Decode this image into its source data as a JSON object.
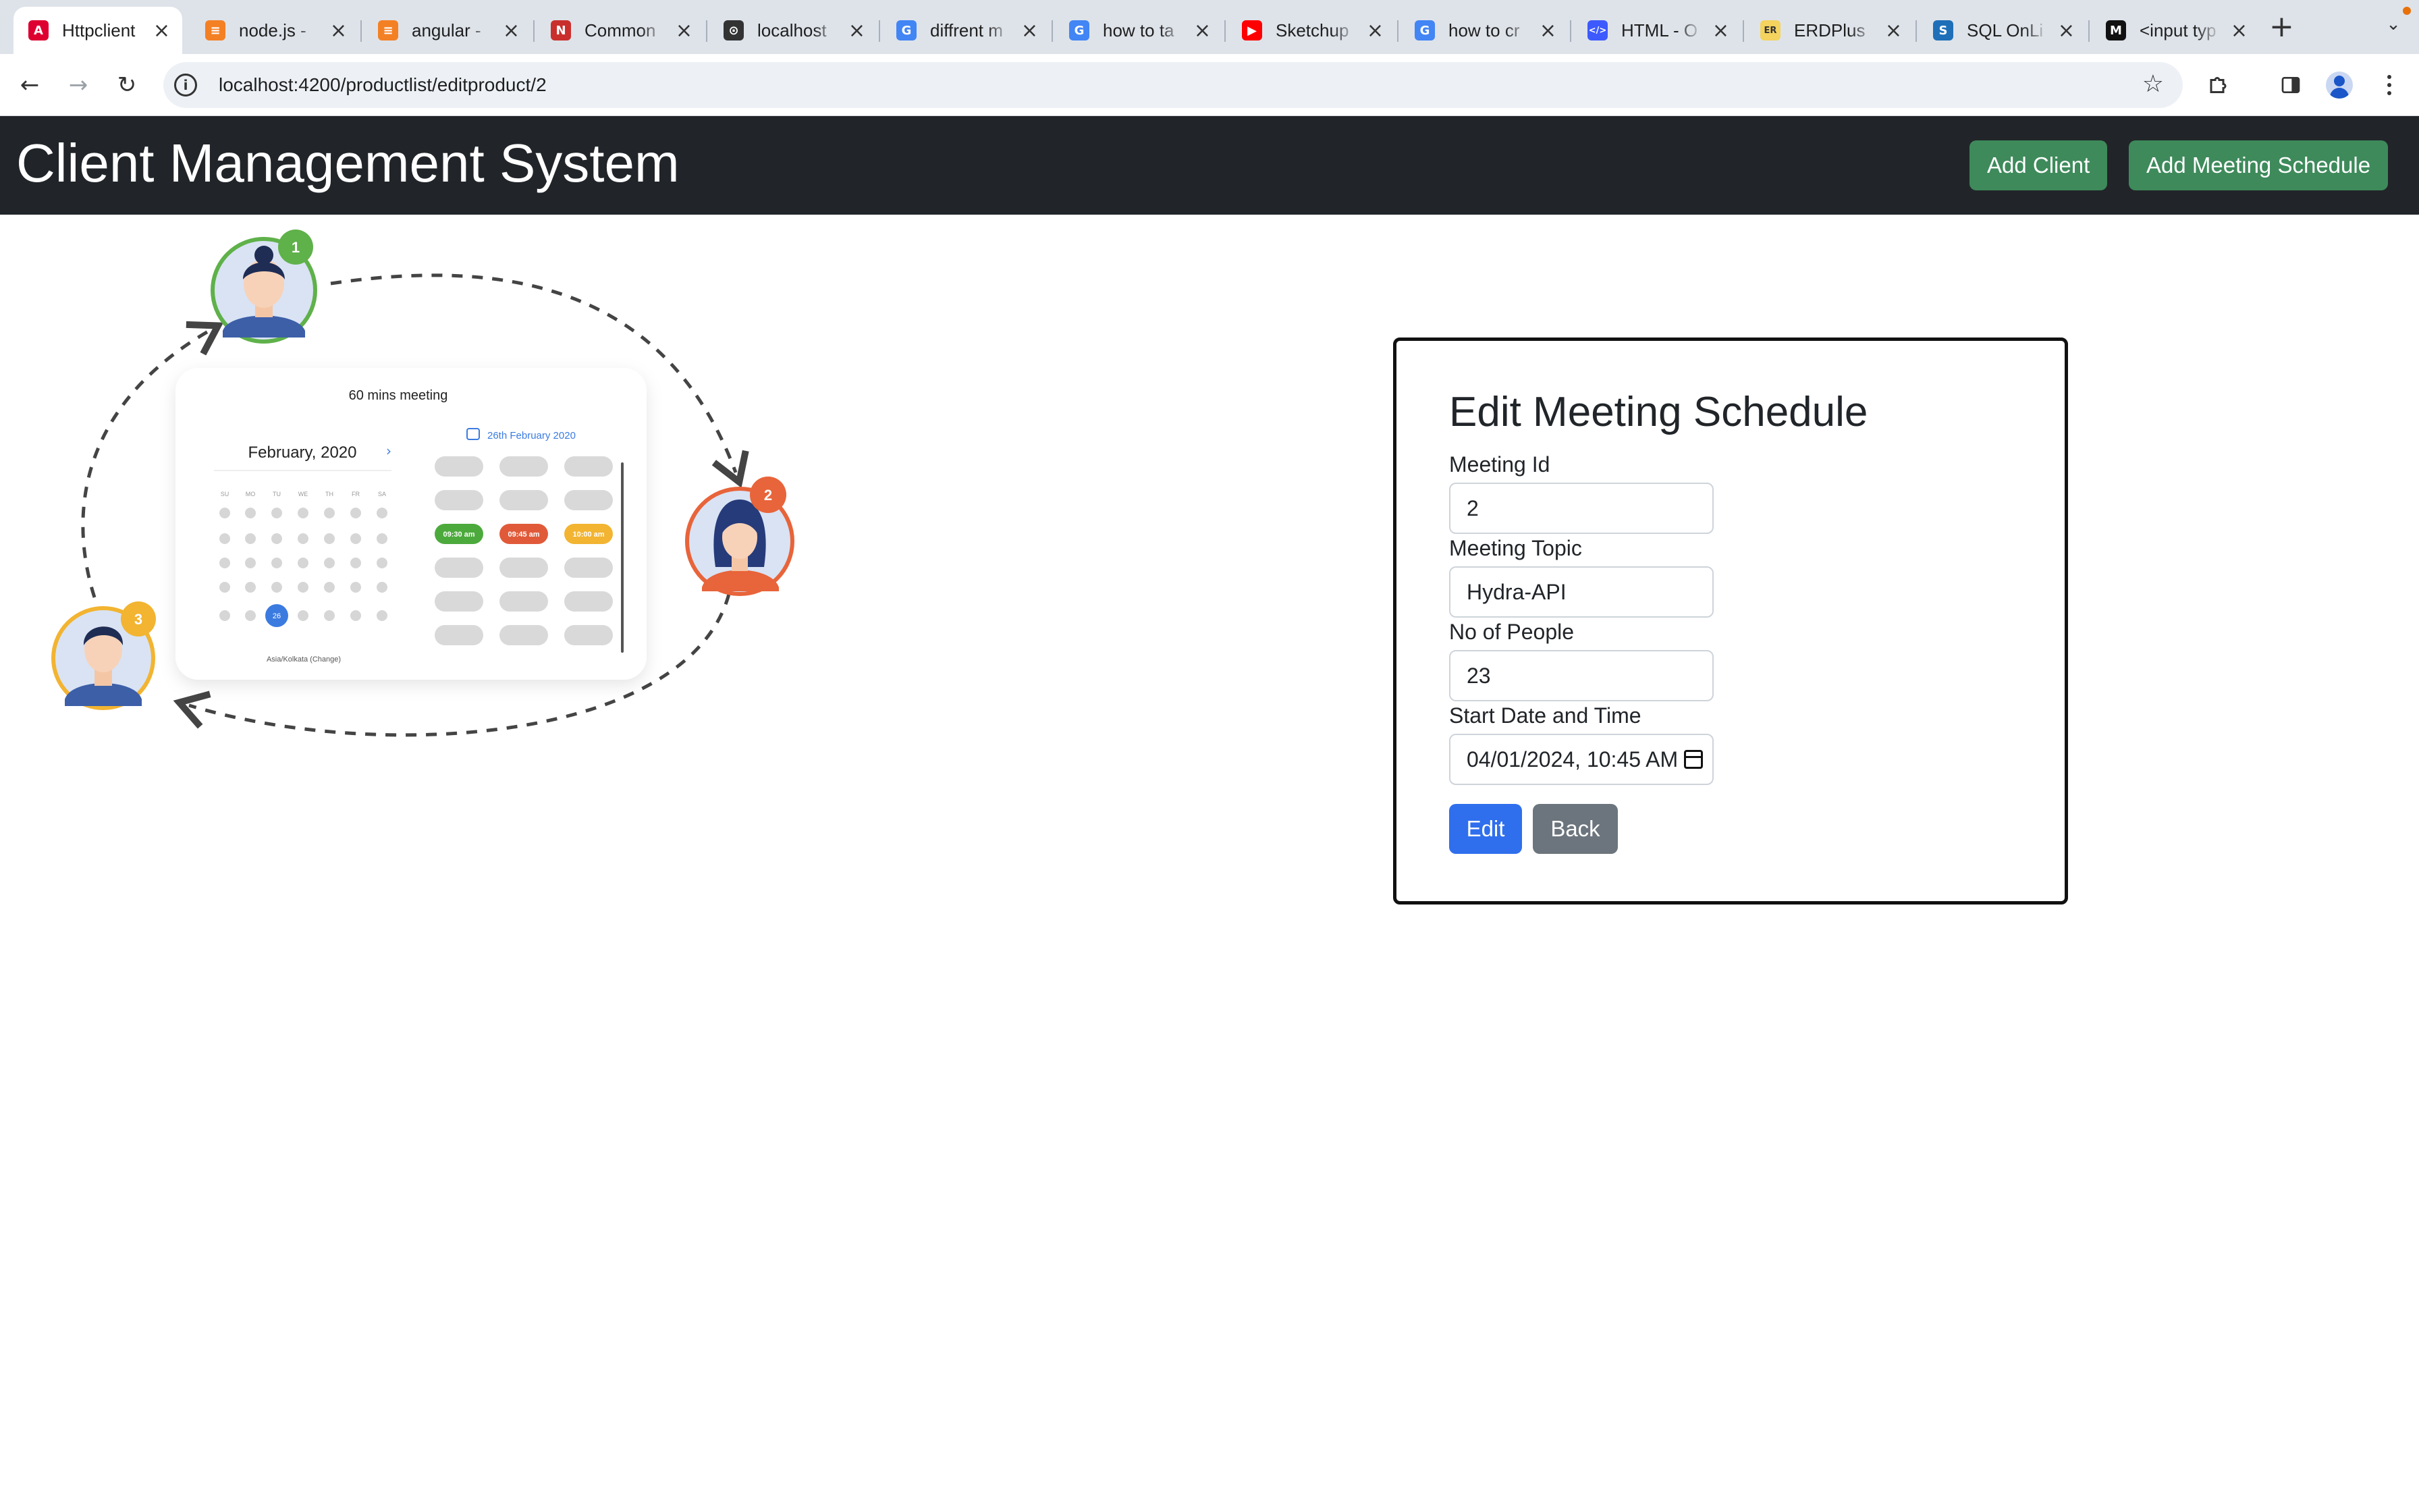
{
  "browser": {
    "tabs": [
      {
        "title": "Httpclient",
        "active": true,
        "icon": "angular-icon",
        "color": "#dd0031"
      },
      {
        "title": "node.js - ",
        "active": false,
        "icon": "stackoverflow-icon",
        "color": "#f48024"
      },
      {
        "title": "angular - ",
        "active": false,
        "icon": "stackoverflow-icon",
        "color": "#f48024"
      },
      {
        "title": "Common ",
        "active": false,
        "icon": "notion-icon",
        "color": "#c9302c"
      },
      {
        "title": "localhost",
        "active": false,
        "icon": "localhost-icon",
        "color": "#333333"
      },
      {
        "title": "diffrent m",
        "active": false,
        "icon": "google-icon",
        "color": "#4285f4"
      },
      {
        "title": "how to ta",
        "active": false,
        "icon": "google-icon",
        "color": "#4285f4"
      },
      {
        "title": "Sketchup",
        "active": false,
        "icon": "youtube-icon",
        "color": "#ff0000"
      },
      {
        "title": "how to cr",
        "active": false,
        "icon": "google-icon",
        "color": "#4285f4"
      },
      {
        "title": "HTML - O",
        "active": false,
        "icon": "code-icon",
        "color": "#3d5afe"
      },
      {
        "title": "ERDPlus",
        "active": false,
        "icon": "erdplus-icon",
        "color": "#f4d35e"
      },
      {
        "title": "SQL OnLi",
        "active": false,
        "icon": "sqlonline-icon",
        "color": "#1e6fb8"
      },
      {
        "title": "<input typ",
        "active": false,
        "icon": "mdn-icon",
        "color": "#111111"
      }
    ],
    "url": "localhost:4200/productlist/editproduct/2"
  },
  "app": {
    "title": "Client Management System",
    "add_client_label": "Add Client",
    "add_meeting_label": "Add Meeting Schedule",
    "accent_green": "#3e8a5b",
    "navbar_color": "#212529"
  },
  "illustration": {
    "meeting_label": "60 mins meeting",
    "month_label": "February, 2020",
    "date_label": "26th February 2020",
    "weekdays": [
      "SU",
      "MO",
      "TU",
      "WE",
      "TH",
      "FR",
      "SA"
    ],
    "selected_day": "26",
    "slots": [
      "09:30 am",
      "09:45 am",
      "10:00 am"
    ],
    "timezone": "Asia/Kolkata (Change)",
    "avatar_numbers": [
      "1",
      "2",
      "3"
    ]
  },
  "form": {
    "title": "Edit Meeting Schedule",
    "meeting_id_label": "Meeting Id",
    "meeting_id_value": "2",
    "topic_label": "Meeting Topic",
    "topic_value": "Hydra-API",
    "people_label": "No of People",
    "people_value": "23",
    "start_label": "Start Date and Time",
    "start_value": "04/01/2024, 10:45 AM",
    "edit_label": "Edit",
    "back_label": "Back",
    "edit_color": "#2f6fed",
    "back_color": "#6c757d"
  }
}
